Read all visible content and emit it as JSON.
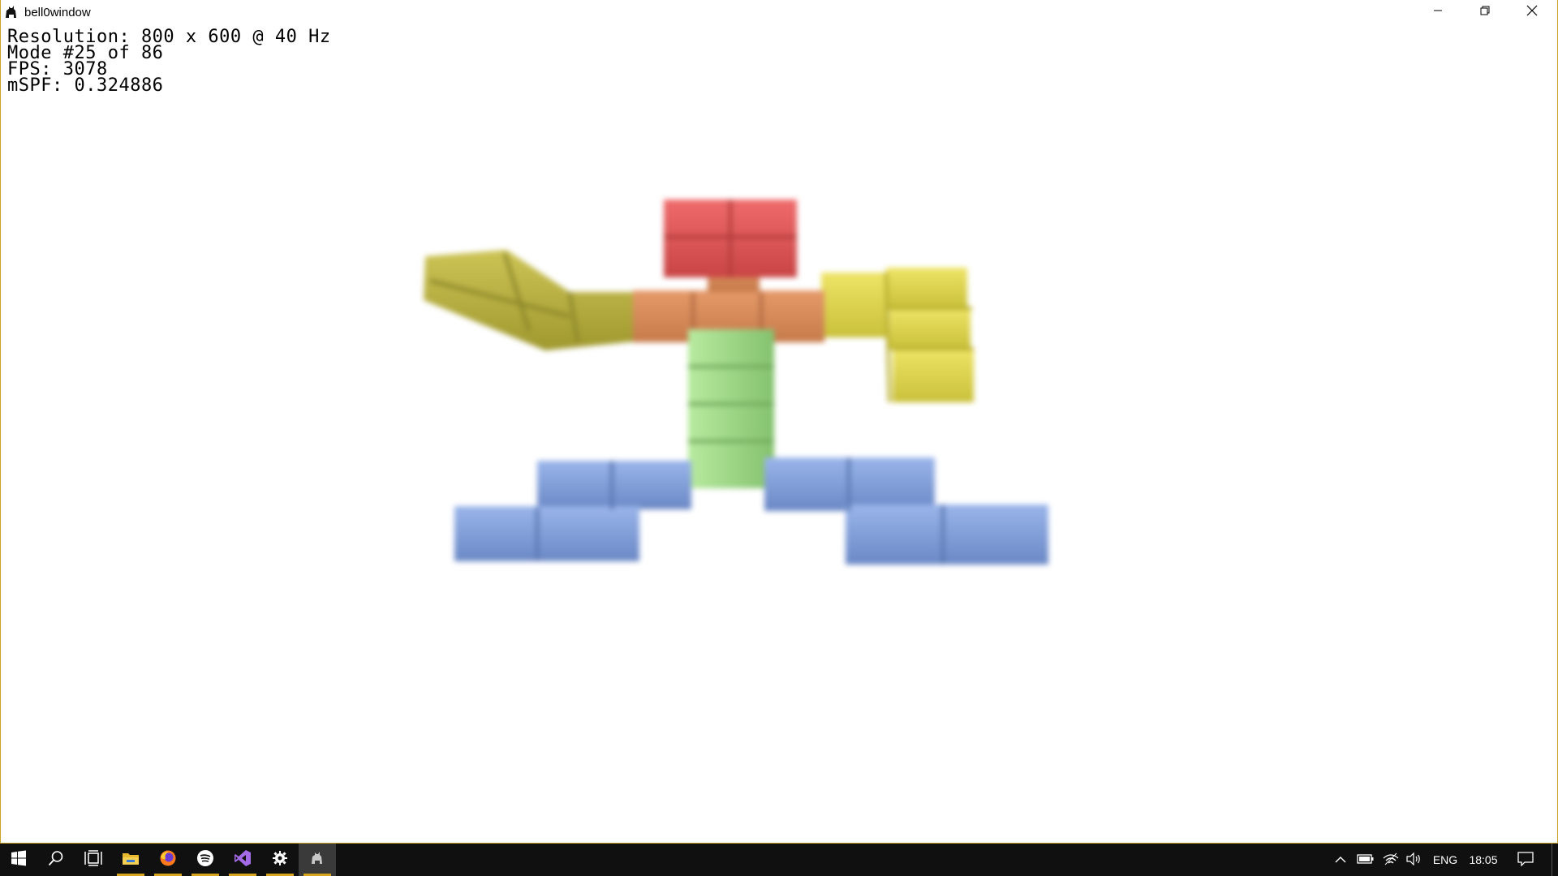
{
  "window": {
    "title": "bell0window",
    "icon": "cat-icon"
  },
  "controls": {
    "minimize": "minimize-icon",
    "restore": "restore-icon",
    "close": "close-icon"
  },
  "overlay": {
    "resolution": "Resolution: 800 x 600 @ 40 Hz",
    "mode": "Mode #25 of 86",
    "fps": "FPS: 3078",
    "mspf": "mSPF: 0.324886"
  },
  "scene": {
    "subject": "blocky 3D voxel figure",
    "colors": {
      "head": "#e05555",
      "neck": "#d98a5a",
      "arms": "#d8cf4a",
      "left_arm": "#b8b03a",
      "torso": "#a6de95",
      "legs": "#7f9fdc"
    }
  },
  "taskbar": {
    "items": [
      {
        "name": "start-button",
        "icon": "windows-icon"
      },
      {
        "name": "search-button",
        "icon": "search-icon"
      },
      {
        "name": "task-view-button",
        "icon": "task-view-icon"
      },
      {
        "name": "file-explorer-button",
        "icon": "folder-icon"
      },
      {
        "name": "firefox-button",
        "icon": "firefox-icon"
      },
      {
        "name": "music-app-button",
        "icon": "spotify-icon"
      },
      {
        "name": "visual-studio-button",
        "icon": "visual-studio-icon"
      },
      {
        "name": "settings-button",
        "icon": "gear-icon"
      },
      {
        "name": "bell0window-taskbar-button",
        "icon": "cat-icon"
      }
    ],
    "tray": {
      "language": "ENG",
      "time": "18:05"
    }
  }
}
